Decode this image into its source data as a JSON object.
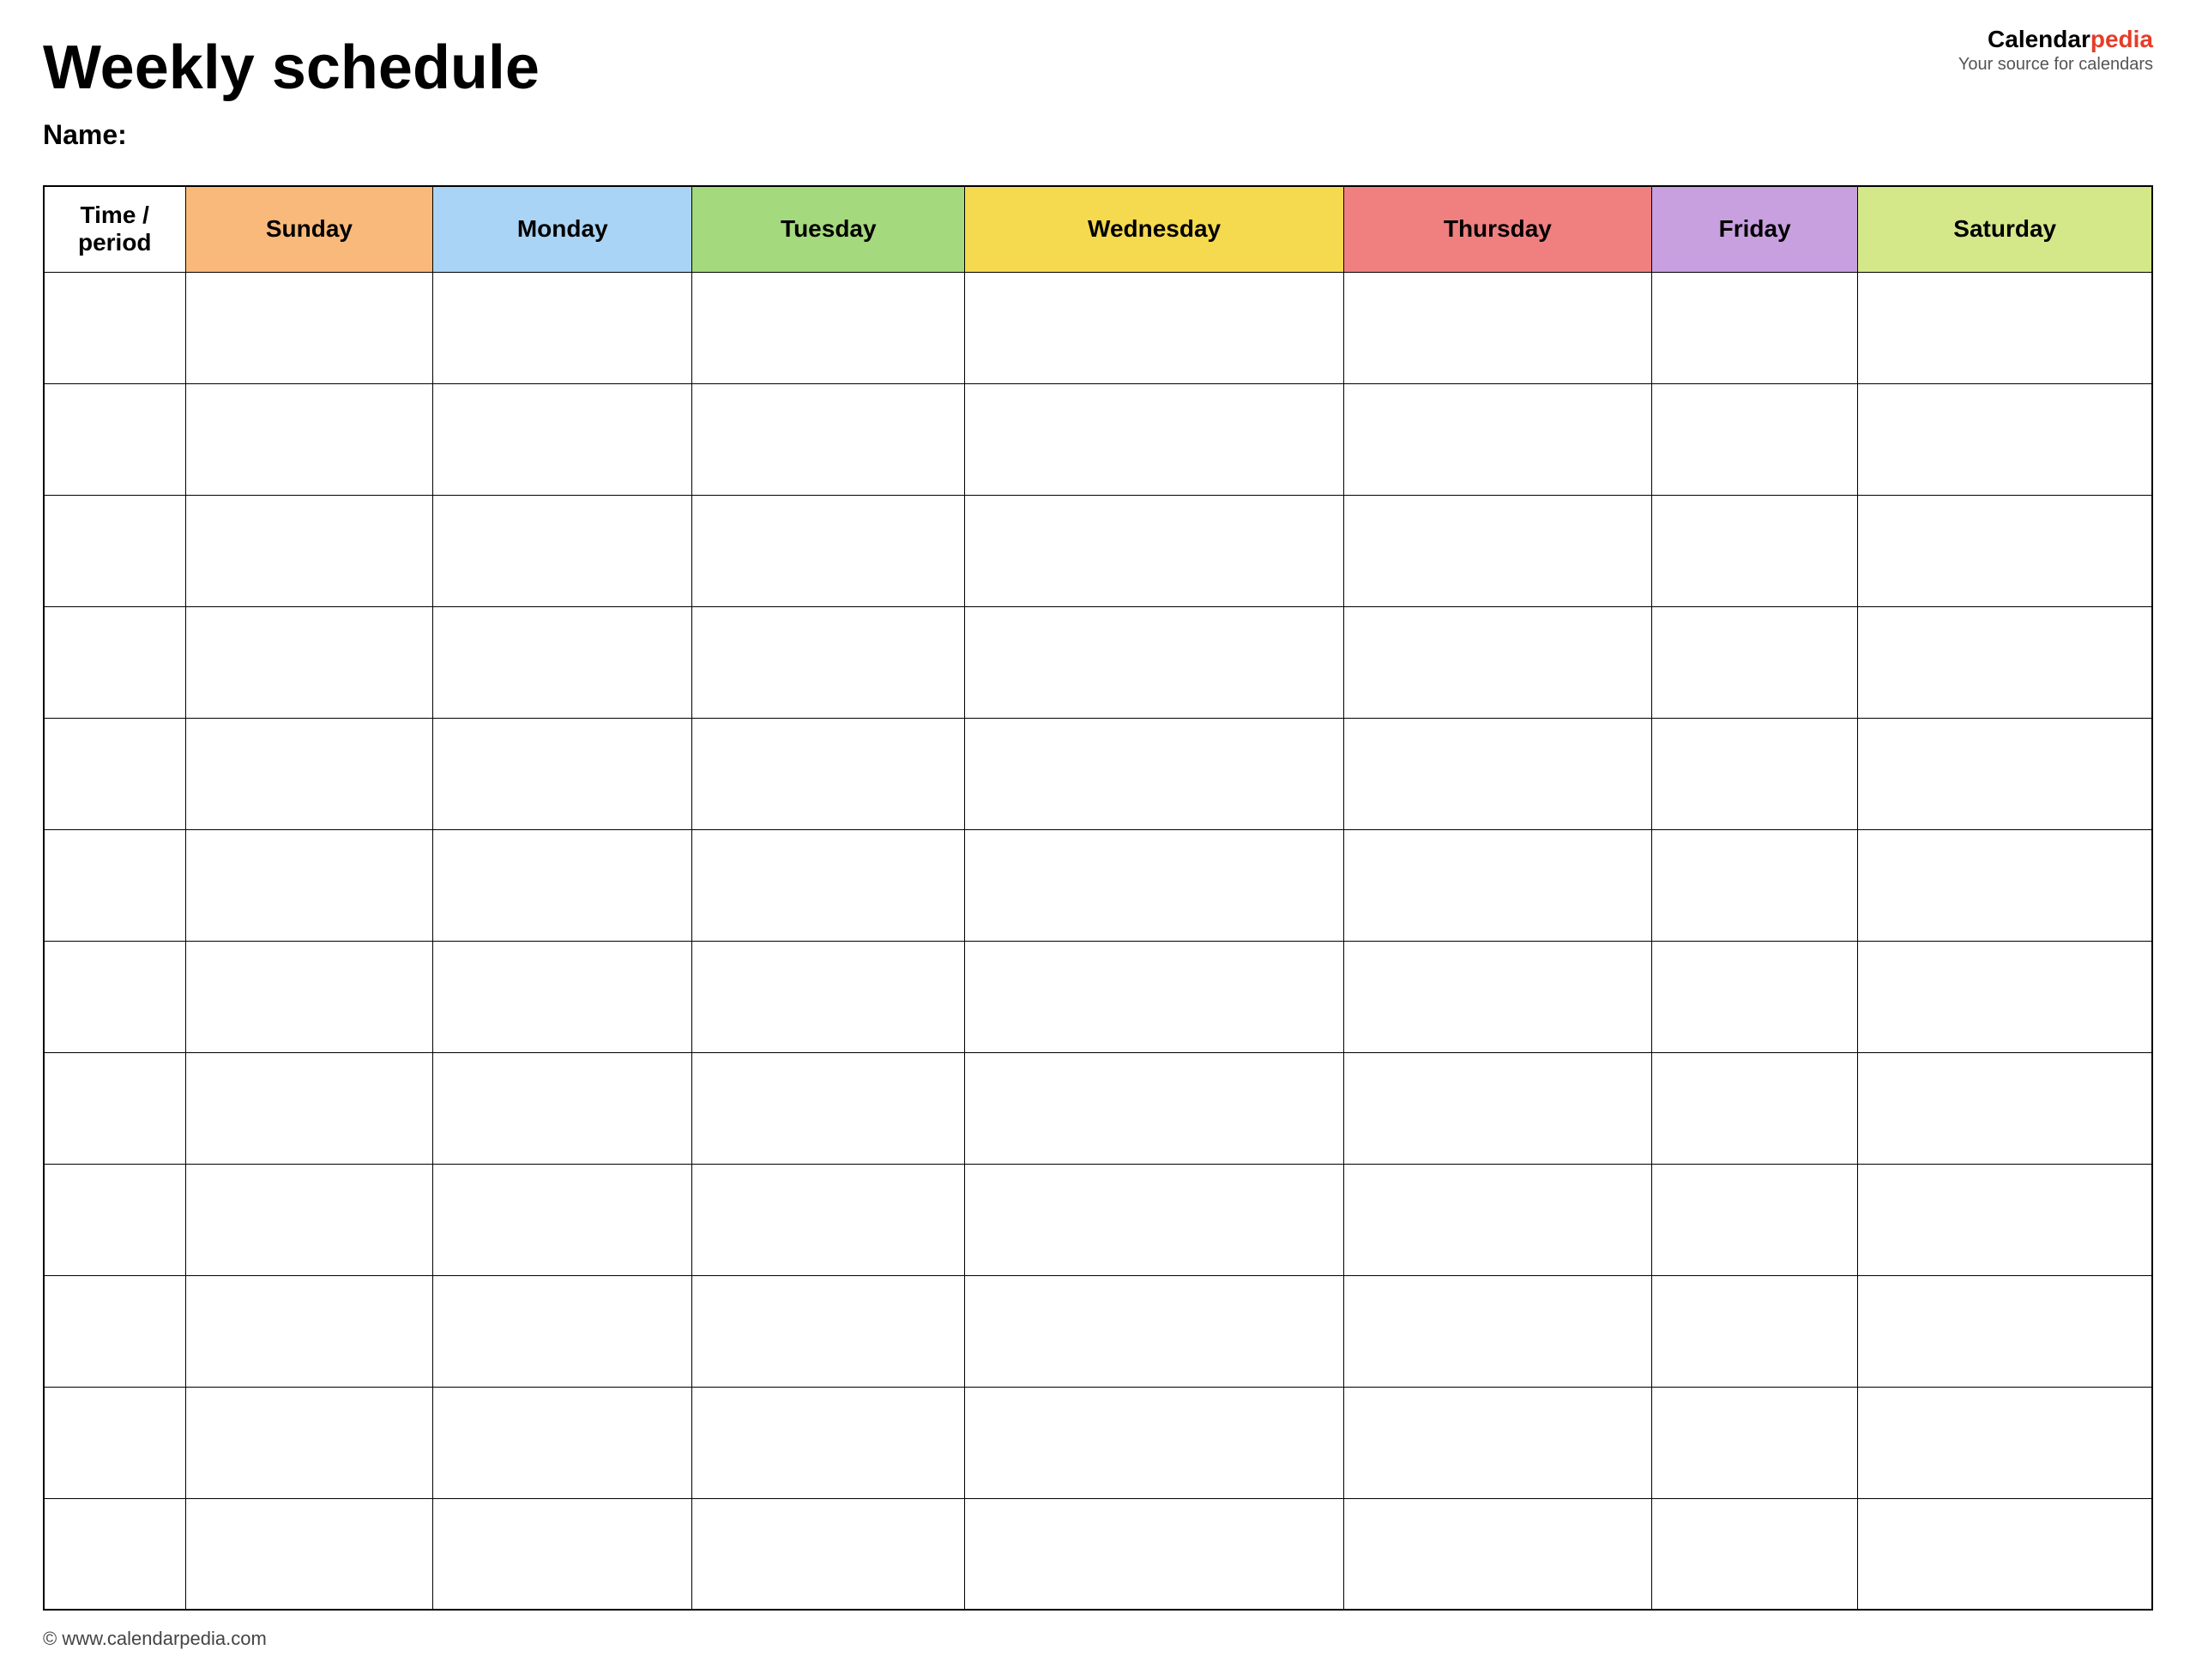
{
  "title": "Weekly schedule",
  "name_label": "Name:",
  "branding": {
    "calendar": "Calendar",
    "pedia": "pedia",
    "tagline": "Your source for calendars"
  },
  "table": {
    "headers": [
      {
        "id": "time",
        "label": "Time / period",
        "color_class": "col-time"
      },
      {
        "id": "sunday",
        "label": "Sunday",
        "color_class": "col-sunday"
      },
      {
        "id": "monday",
        "label": "Monday",
        "color_class": "col-monday"
      },
      {
        "id": "tuesday",
        "label": "Tuesday",
        "color_class": "col-tuesday"
      },
      {
        "id": "wednesday",
        "label": "Wednesday",
        "color_class": "col-wednesday"
      },
      {
        "id": "thursday",
        "label": "Thursday",
        "color_class": "col-thursday"
      },
      {
        "id": "friday",
        "label": "Friday",
        "color_class": "col-friday"
      },
      {
        "id": "saturday",
        "label": "Saturday",
        "color_class": "col-saturday"
      }
    ],
    "row_count": 12
  },
  "footer": {
    "copyright": "© www.calendarpedia.com"
  }
}
